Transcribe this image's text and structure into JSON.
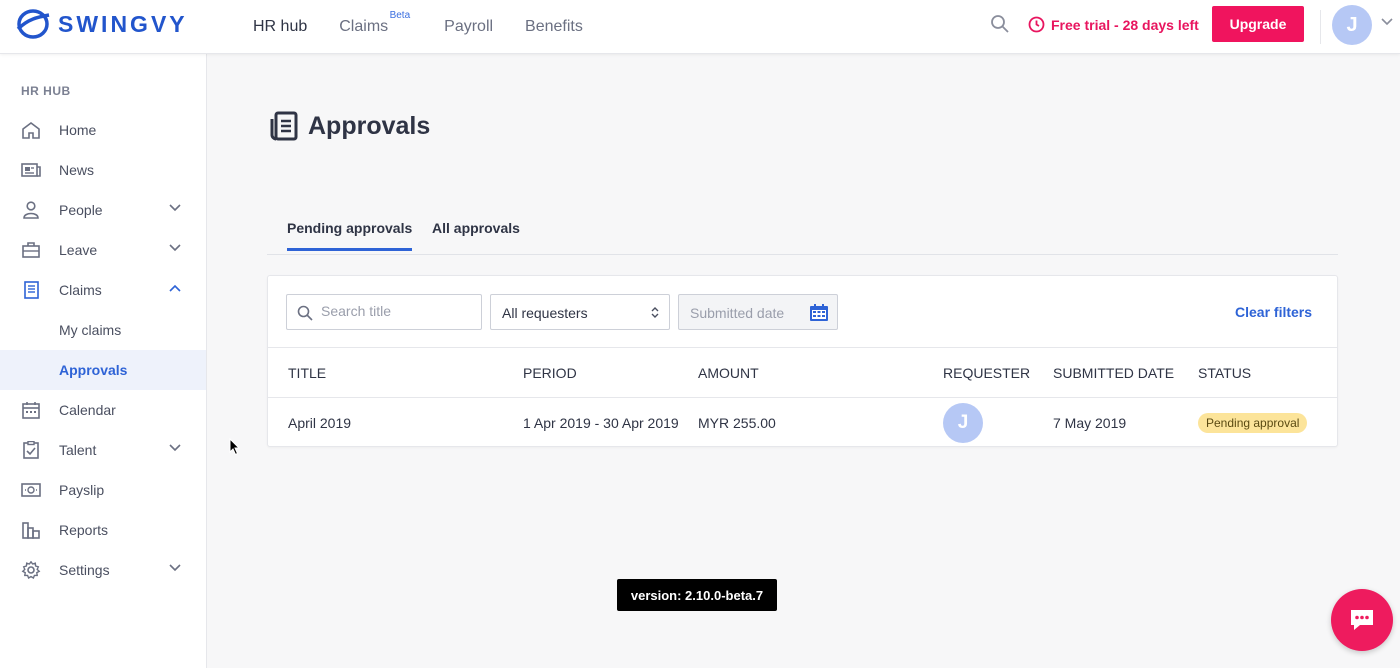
{
  "brand": {
    "name": "SWINGVY",
    "color": "#2255cc"
  },
  "topnav": {
    "items": [
      {
        "label": "HR hub",
        "active": true
      },
      {
        "label": "Claims",
        "badge": "Beta"
      },
      {
        "label": "Payroll"
      },
      {
        "label": "Benefits"
      }
    ],
    "trial_text": "Free trial - 28 days left",
    "upgrade_label": "Upgrade",
    "avatar_initial": "J"
  },
  "sidebar": {
    "heading": "HR HUB",
    "items": [
      {
        "label": "Home",
        "icon": "home-icon"
      },
      {
        "label": "News",
        "icon": "news-icon"
      },
      {
        "label": "People",
        "icon": "person-icon",
        "expandable": true
      },
      {
        "label": "Leave",
        "icon": "briefcase-icon",
        "expandable": true
      },
      {
        "label": "Claims",
        "icon": "document-icon",
        "expanded": true
      },
      {
        "label": "My claims",
        "sub": true
      },
      {
        "label": "Approvals",
        "sub": true,
        "active": true
      },
      {
        "label": "Calendar",
        "icon": "calendar-icon"
      },
      {
        "label": "Talent",
        "icon": "clipboard-icon",
        "expandable": true
      },
      {
        "label": "Payslip",
        "icon": "money-icon"
      },
      {
        "label": "Reports",
        "icon": "bar-chart-icon"
      },
      {
        "label": "Settings",
        "icon": "gear-icon",
        "expandable": true
      }
    ]
  },
  "page": {
    "title": "Approvals",
    "tabs": [
      {
        "label": "Pending approvals",
        "active": true
      },
      {
        "label": "All approvals"
      }
    ]
  },
  "filters": {
    "search_placeholder": "Search title",
    "requester_value": "All requesters",
    "date_placeholder": "Submitted date",
    "clear_label": "Clear filters"
  },
  "table": {
    "columns": [
      "TITLE",
      "PERIOD",
      "AMOUNT",
      "REQUESTER",
      "SUBMITTED DATE",
      "STATUS"
    ],
    "rows": [
      {
        "title": "April 2019",
        "period": "1 Apr 2019 - 30 Apr 2019",
        "amount": "MYR 255.00",
        "requester_initial": "J",
        "submitted": "7 May 2019",
        "status": "Pending approval"
      }
    ]
  },
  "version": "version:  2.10.0-beta.7",
  "colors": {
    "accent": "#2e63d6",
    "danger": "#f0145e",
    "pending": "#fce49a"
  }
}
